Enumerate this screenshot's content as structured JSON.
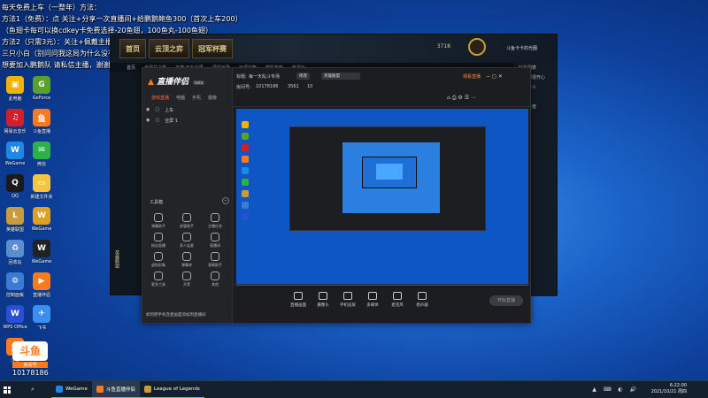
{
  "overlay": {
    "lines": [
      "每天免费上车（一整年）方法：",
      "方法1（免费）：点 关注+分享一次直播间+给鹏鹅鲍鱼300（首次上车200）",
      "（鱼翅卡每可以换cdkey卡免费选择-20鱼翅，100鱼丸-100鱼翅）",
      "方法2（只需3元）：关注+佩戴主播粉丝牌+送元宝光棒",
      "三只小白（别问问我这局为什么没有主播就开播了时日天拉不住不被遗弃）",
      "想要加入鹏鹅队 请私信主播，谢谢大家的支持！"
    ]
  },
  "desktop_icons": [
    {
      "label": "此电脑",
      "color": "#f0b400",
      "glyph": "▣"
    },
    {
      "label": "GeForce",
      "color": "#5aa02c",
      "glyph": "G"
    },
    {
      "label": "网易云音乐",
      "color": "#d21f2a",
      "glyph": "♫"
    },
    {
      "label": "斗鱼直播",
      "color": "#ff7a1a",
      "glyph": "鱼"
    },
    {
      "label": "WeGame",
      "color": "#1e88e5",
      "glyph": "W"
    },
    {
      "label": "微信",
      "color": "#2fb14a",
      "glyph": "✉"
    },
    {
      "label": "QQ",
      "color": "#1a1a1a",
      "glyph": "Q"
    },
    {
      "label": "新建文件夹",
      "color": "#f5c542",
      "glyph": "▭"
    },
    {
      "label": "英雄联盟",
      "color": "#c89b3c",
      "glyph": "L"
    },
    {
      "label": "WeGame",
      "color": "#e0a020",
      "glyph": "W"
    },
    {
      "label": "回收站",
      "color": "#5b8ecf",
      "glyph": "♻"
    },
    {
      "label": "WeGame",
      "color": "#222",
      "glyph": "W"
    },
    {
      "label": "控制面板",
      "color": "#3a7bd5",
      "glyph": "⚙"
    },
    {
      "label": "直播伴侣",
      "color": "#ff7a1a",
      "glyph": "▶"
    },
    {
      "label": "WPS Office",
      "color": "#2a4fd6",
      "glyph": "W"
    },
    {
      "label": "飞书",
      "color": "#3a8ff0",
      "glyph": "✈"
    },
    {
      "label": "斗鱼",
      "color": "#ff7a1a",
      "glyph": "鱼"
    }
  ],
  "game": {
    "tabs": [
      "首页",
      "云顶之弈",
      "冠军杯赛"
    ],
    "nav": [
      "首页",
      "全球总决赛",
      "不被/不在这里",
      "福星目录",
      "云顶宝箱",
      "邮件宣传",
      "电视台"
    ],
    "currency": "3718",
    "player": "斗鱼卡卡的光圈",
    "right_panel": [
      "好友列表",
      "大家都很开心",
      "你好个人",
      "一个人",
      "很帅王者",
      "队友"
    ],
    "footer_label": "英雄联盟"
  },
  "app": {
    "brand": "直播伴侣",
    "brand_tag": "beta",
    "side_tabs": [
      "游戏直播",
      "电脑",
      "手机",
      "摄像"
    ],
    "scenes": [
      "上车",
      "全屏 1"
    ],
    "tools_title": "工具箱",
    "tools": [
      "弹幕助手",
      "房管助手",
      "主播任务",
      "粉丝直播",
      "多人连麦",
      "直播间",
      "虚拟形象",
      "弹幕库",
      "表情助手",
      "更多工具",
      "开黑",
      "其他"
    ],
    "tip": "如何把手机连麦画面添加到直播间",
    "header": {
      "title_label": "标题:",
      "title_value": "每一天乱斗专场",
      "edit_label": "修改",
      "category": "英雄联盟",
      "room_label": "房间号:",
      "room_id": "10178186",
      "viewers": "3561",
      "stat": "10",
      "fans": "粉丝:",
      "watch_btn": "观看直播"
    },
    "bottom_buttons": [
      "直播画面",
      "摄像头",
      "手机投屏",
      "多媒体",
      "麦克风",
      "扬声器"
    ],
    "go_live": "开始直播"
  },
  "logo_overlay": {
    "text": "斗鱼",
    "sub": "房间号",
    "room": "10178186"
  },
  "taskbar": {
    "items": [
      {
        "label": "WeGame",
        "color": "#1e88e5"
      },
      {
        "label": "斗鱼直播伴侣",
        "color": "#ff7a1a"
      },
      {
        "label": "League of Legends",
        "color": "#c89b3c"
      }
    ],
    "time": "6:22:00",
    "date": "2021/10/21 周四"
  }
}
